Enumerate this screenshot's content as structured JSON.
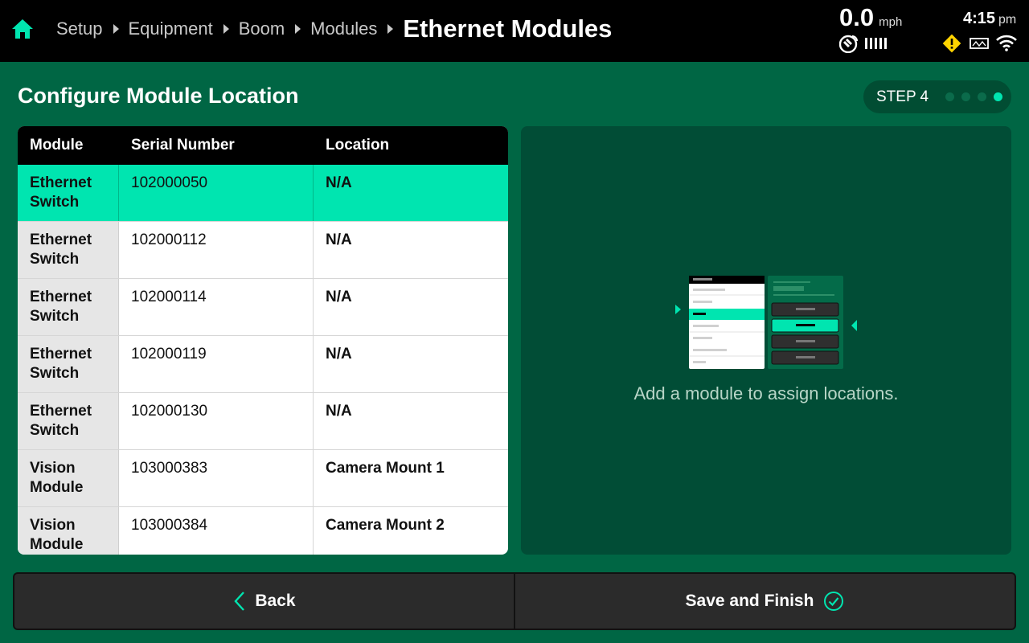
{
  "header": {
    "breadcrumbs": [
      "Setup",
      "Equipment",
      "Boom",
      "Modules"
    ],
    "current": "Ethernet Modules",
    "speed": "0.0",
    "speed_unit": "mph",
    "time": "4:15",
    "time_suffix": "pm"
  },
  "page": {
    "title": "Configure Module Location",
    "step_label": "STEP 4",
    "step_total": 4,
    "step_current": 4
  },
  "table": {
    "columns": [
      "Module",
      "Serial Number",
      "Location"
    ],
    "rows": [
      {
        "module": "Ethernet Switch",
        "serial": "102000050",
        "location": "N/A",
        "selected": true
      },
      {
        "module": "Ethernet Switch",
        "serial": "102000112",
        "location": "N/A"
      },
      {
        "module": "Ethernet Switch",
        "serial": "102000114",
        "location": "N/A"
      },
      {
        "module": "Ethernet Switch",
        "serial": "102000119",
        "location": "N/A"
      },
      {
        "module": "Ethernet Switch",
        "serial": "102000130",
        "location": "N/A"
      },
      {
        "module": "Vision Module",
        "serial": "103000383",
        "location": "Camera Mount 1"
      },
      {
        "module": "Vision Module",
        "serial": "103000384",
        "location": "Camera Mount 2"
      }
    ]
  },
  "panel": {
    "message": "Add a module to assign locations."
  },
  "footer": {
    "back_label": "Back",
    "finish_label": "Save and Finish"
  },
  "colors": {
    "accent": "#00e5b0",
    "background": "#006644",
    "panel": "#014d36",
    "warning": "#ffd400"
  },
  "icons": [
    "home-icon",
    "chevron-right-icon",
    "satellite-icon",
    "signal-bars-icon",
    "warning-icon",
    "boom-icon",
    "wifi-icon",
    "chevron-left-icon",
    "check-circle-icon"
  ]
}
